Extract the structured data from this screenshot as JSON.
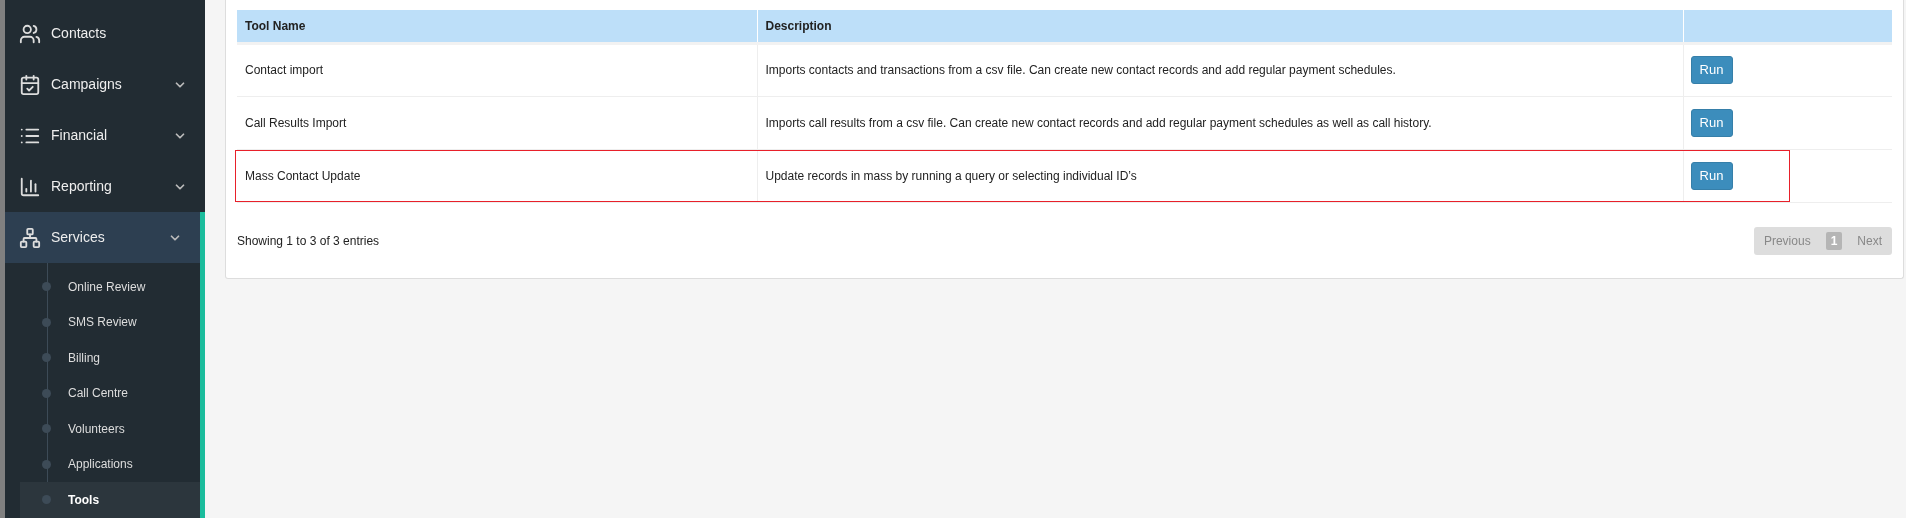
{
  "sidebar": {
    "items": [
      {
        "label": "Contacts",
        "has_caret": false,
        "expanded": false
      },
      {
        "label": "Campaigns",
        "has_caret": true,
        "expanded": false
      },
      {
        "label": "Financial",
        "has_caret": true,
        "expanded": false
      },
      {
        "label": "Reporting",
        "has_caret": true,
        "expanded": false
      },
      {
        "label": "Services",
        "has_caret": true,
        "expanded": true,
        "children": [
          {
            "label": "Online Review",
            "selected": false
          },
          {
            "label": "SMS Review",
            "selected": false
          },
          {
            "label": "Billing",
            "selected": false
          },
          {
            "label": "Call Centre",
            "selected": false
          },
          {
            "label": "Volunteers",
            "selected": false
          },
          {
            "label": "Applications",
            "selected": false
          },
          {
            "label": "Tools",
            "selected": true
          }
        ]
      }
    ]
  },
  "table": {
    "columns": [
      "Tool Name",
      "Description"
    ],
    "rows": [
      {
        "name": "Contact import",
        "description": "Imports contacts and transactions from a csv file. Can create new contact records and add regular payment schedules.",
        "action": "Run",
        "highlighted": false
      },
      {
        "name": "Call Results Import",
        "description": "Imports call results from a csv file. Can create new contact records and add regular payment schedules as well as call history.",
        "action": "Run",
        "highlighted": false
      },
      {
        "name": "Mass Contact Update",
        "description": "Update records in mass by running a query or selecting individual ID’s",
        "action": "Run",
        "highlighted": true
      }
    ]
  },
  "footer": {
    "info": "Showing 1 to 3 of 3 entries",
    "pagination": [
      {
        "label": "Previous",
        "kind": "prev",
        "disabled": true
      },
      {
        "label": "1",
        "kind": "page",
        "selected": true
      },
      {
        "label": "Next",
        "kind": "next",
        "disabled": true
      }
    ]
  }
}
